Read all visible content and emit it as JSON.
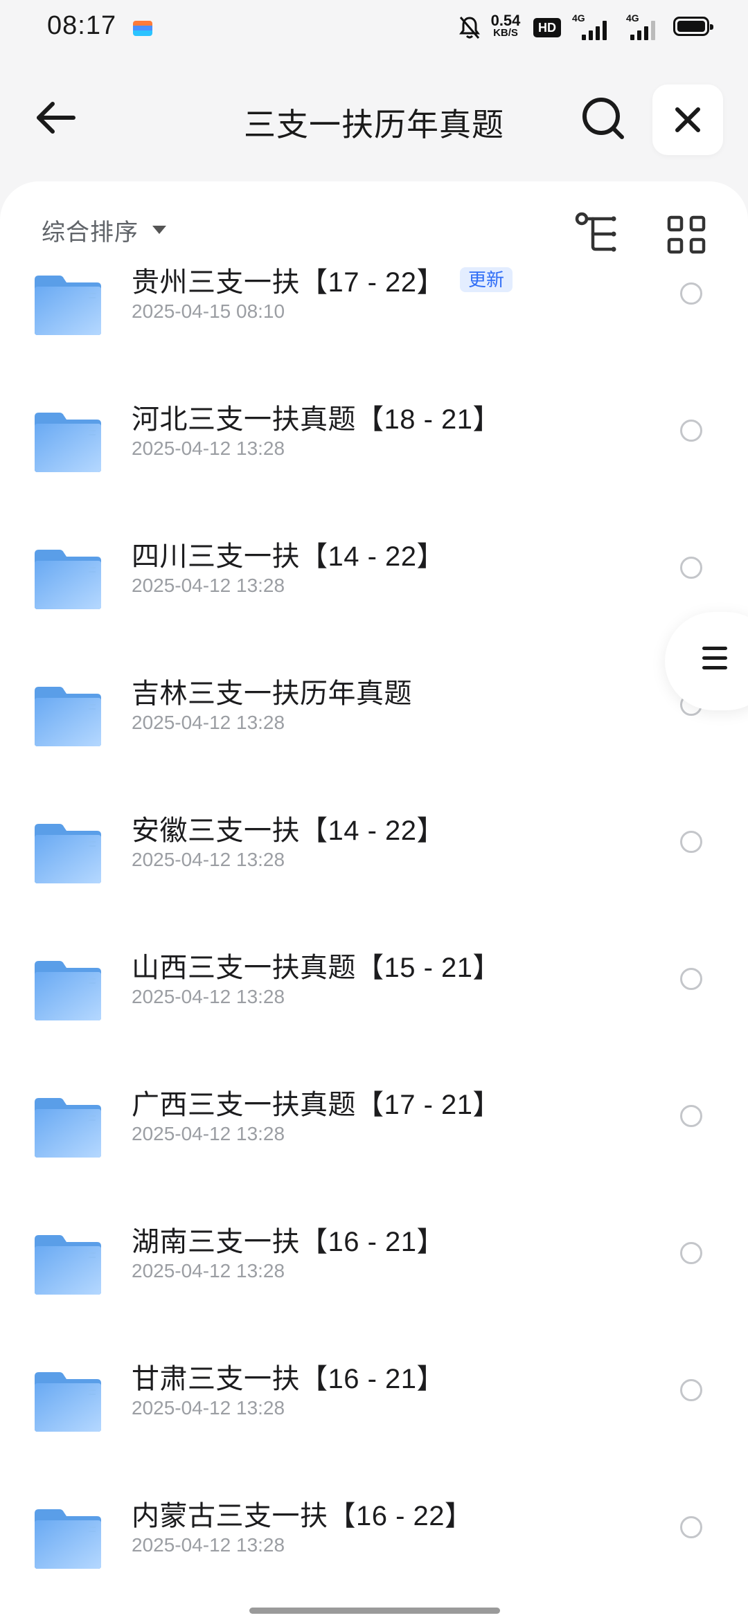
{
  "status_bar": {
    "time": "08:17",
    "net_speed": "0.54",
    "net_unit": "KB/S",
    "hd": "HD",
    "sim1": "4G",
    "sim2": "4G"
  },
  "header": {
    "title": "三支一扶历年真题",
    "back_icon": "arrow-left-icon",
    "search_icon": "search-icon",
    "close_icon": "close-icon"
  },
  "sort": {
    "label": "综合排序",
    "tree_icon": "tree-view-icon",
    "grid_icon": "grid-view-icon"
  },
  "files": [
    {
      "name": "贵州三支一扶【17 - 22】",
      "date": "2025-04-15 08:10",
      "badge": "更新"
    },
    {
      "name": "河北三支一扶真题【18 - 21】",
      "date": "2025-04-12 13:28"
    },
    {
      "name": "四川三支一扶【14 - 22】",
      "date": "2025-04-12 13:28"
    },
    {
      "name": "吉林三支一扶历年真题",
      "date": "2025-04-12 13:28"
    },
    {
      "name": "安徽三支一扶【14 - 22】",
      "date": "2025-04-12 13:28"
    },
    {
      "name": "山西三支一扶真题【15 - 21】",
      "date": "2025-04-12 13:28"
    },
    {
      "name": "广西三支一扶真题【17 - 21】",
      "date": "2025-04-12 13:28"
    },
    {
      "name": "湖南三支一扶【16 - 21】",
      "date": "2025-04-12 13:28"
    },
    {
      "name": "甘肃三支一扶【16 - 21】",
      "date": "2025-04-12 13:28"
    },
    {
      "name": "内蒙古三支一扶【16 - 22】",
      "date": "2025-04-12 13:28"
    }
  ],
  "colors": {
    "folder": "#6aaaf3",
    "badge_bg": "#e3edff",
    "badge_text": "#2f6df6",
    "date_text": "#9b9ea3"
  }
}
